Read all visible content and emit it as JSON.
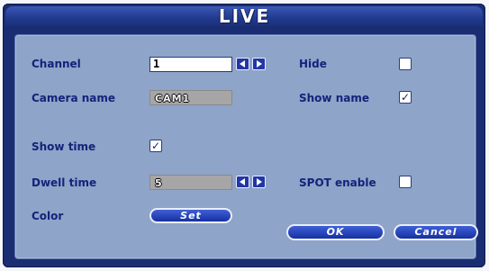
{
  "window": {
    "title": "LIVE"
  },
  "form": {
    "channel_label": "Channel",
    "channel_value": "1",
    "hide_label": "Hide",
    "hide_checked": false,
    "camera_name_label": "Camera name",
    "camera_name_value": "CAM1",
    "show_name_label": "Show name",
    "show_name_checked": true,
    "show_time_label": "Show time",
    "show_time_checked": true,
    "dwell_time_label": "Dwell time",
    "dwell_time_value": "5",
    "spot_enable_label": "SPOT enable",
    "spot_enable_checked": false,
    "color_label": "Color",
    "set_button": "Set"
  },
  "buttons": {
    "ok": "OK",
    "cancel": "Cancel"
  },
  "icons": {
    "decrement": "triangle-left-icon",
    "increment": "triangle-right-icon",
    "check": "checkmark-icon"
  },
  "colors": {
    "frame": "#1a2d72",
    "panel": "#8ea4c8",
    "label_text": "#13237a",
    "button": "#1f3bb8"
  }
}
